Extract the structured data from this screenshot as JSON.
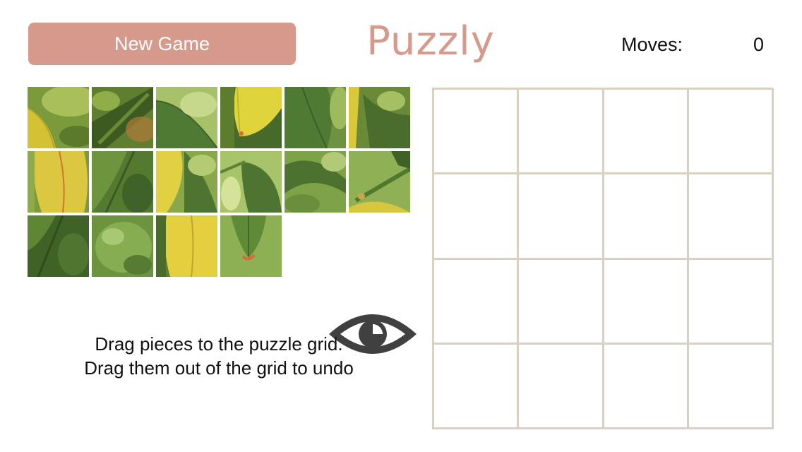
{
  "header": {
    "new_game_label": "New Game",
    "app_title": "Puzzly",
    "moves_label": "Moves:",
    "moves_value": "0"
  },
  "colors": {
    "accent": "#d59a8c",
    "grid_line": "#d8d0c0",
    "eye_icon": "#404040"
  },
  "preview_icon": "eye-icon",
  "instructions": {
    "line1": "Drag pieces to the puzzle grid.",
    "line2": "Drag them out of the grid to undo"
  },
  "tray": {
    "piece_count": 16
  },
  "puzzle_grid": {
    "rows": 4,
    "columns": 4,
    "filled_cells": 0
  }
}
